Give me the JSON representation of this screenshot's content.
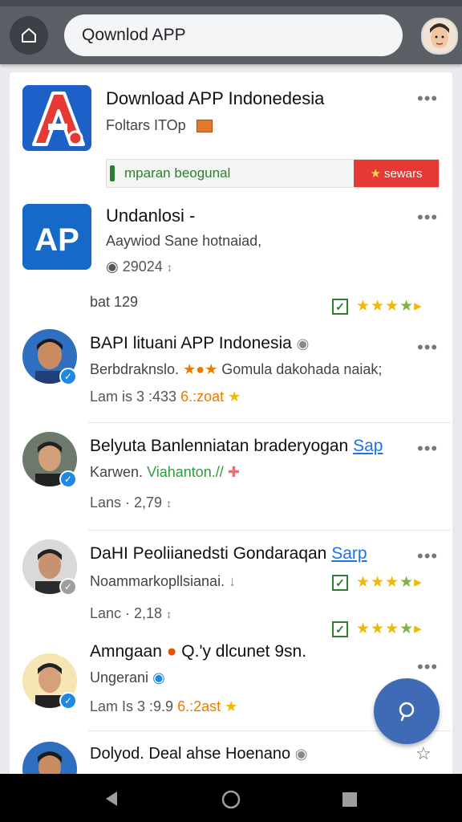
{
  "search": {
    "value": "Qownlod APP"
  },
  "apps": [
    {
      "title": "Download APP Indonedesia",
      "subtitle": "Foltars ITOp",
      "promo_text": "mparan beogunal",
      "promo_button": "sewars"
    },
    {
      "title": "Undanlosi -",
      "subtitle": "Aaywiod Sane hotnaiad,",
      "count": "29024",
      "bottom_label": "bat 129"
    }
  ],
  "posts": [
    {
      "title": "BAPI lituani APP Indonesia",
      "line2": "Berbdraknslo.",
      "line2_extra": "Gomula dakohada naiak;",
      "meta": "Lam is  3 :433",
      "meta_accent": "6.:zoat"
    },
    {
      "title": "Belyuta Banlenniatan braderyogan",
      "title_link": "Sap",
      "line2": "Karwen.",
      "line2_accent": "Viahanton.//",
      "meta": "Lans ·  2,79"
    },
    {
      "title": "DaHI Peoliianedsti Gondaraqan",
      "title_link": "Sarp",
      "line2": "Noammarkopllsianai.",
      "meta": "Lanc ·  2,18"
    },
    {
      "title": "Amngaan",
      "title_extra": "Q.'y dlcunet 9sn.",
      "line2": "Ungerani",
      "meta": "Lam Is  3 :9.9",
      "meta_accent": "6.:2ast"
    },
    {
      "title": "Dolyod. Deal ahse Hoenano"
    }
  ],
  "colors": {
    "topbar": "#5a5f66",
    "accent_blue": "#1a73e8",
    "fab": "#3f6bb6",
    "promo_red": "#e53935",
    "star": "#f2b705",
    "verified": "#1e88e5"
  },
  "icons": {
    "home": "home-icon",
    "more": "more-horizontal-icon",
    "fab": "help-icon",
    "nav_back": "triangle-back-icon",
    "nav_home": "circle-home-icon",
    "nav_recents": "square-recents-icon"
  }
}
